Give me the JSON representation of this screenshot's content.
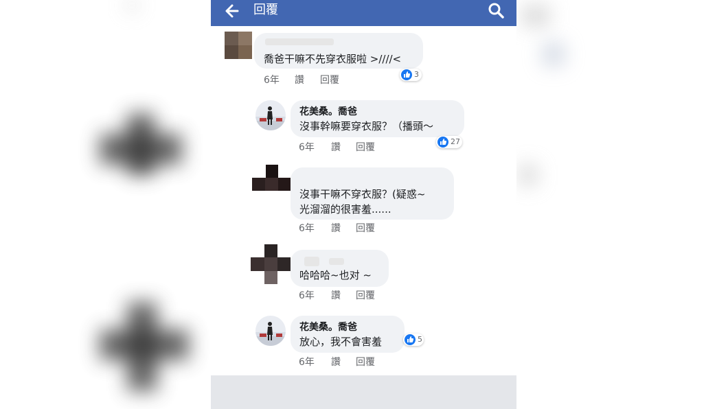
{
  "header": {
    "title": "回覆"
  },
  "comments": [
    {
      "text": "喬爸干嘛不先穿衣服啦 >////<",
      "time": "6年",
      "like_label": "讚",
      "reply_label": "回覆",
      "reactions": "3"
    },
    {
      "author": "花美桑。喬爸",
      "text": "沒事幹嘛要穿衣服？（播頭～",
      "time": "6年",
      "like_label": "讚",
      "reply_label": "回覆",
      "reactions": "27"
    },
    {
      "text_line1": "沒事干嘛不穿衣服？(疑惑~",
      "text_line2": "光溜溜的很害羞......",
      "time": "6年",
      "like_label": "讚",
      "reply_label": "回覆"
    },
    {
      "text": "哈哈哈~也对 ~",
      "time": "6年",
      "like_label": "讚",
      "reply_label": "回覆"
    },
    {
      "author": "花美桑。喬爸",
      "text": "放心，我不會害羞",
      "time": "6年",
      "like_label": "讚",
      "reply_label": "回覆",
      "reactions": "5"
    }
  ],
  "colors": {
    "header": "#4267b2",
    "bubble": "#f0f2f5",
    "like": "#1877f2"
  },
  "icons": {
    "back": "back-arrow-icon",
    "search": "search-icon",
    "reaction": "like-icon"
  }
}
